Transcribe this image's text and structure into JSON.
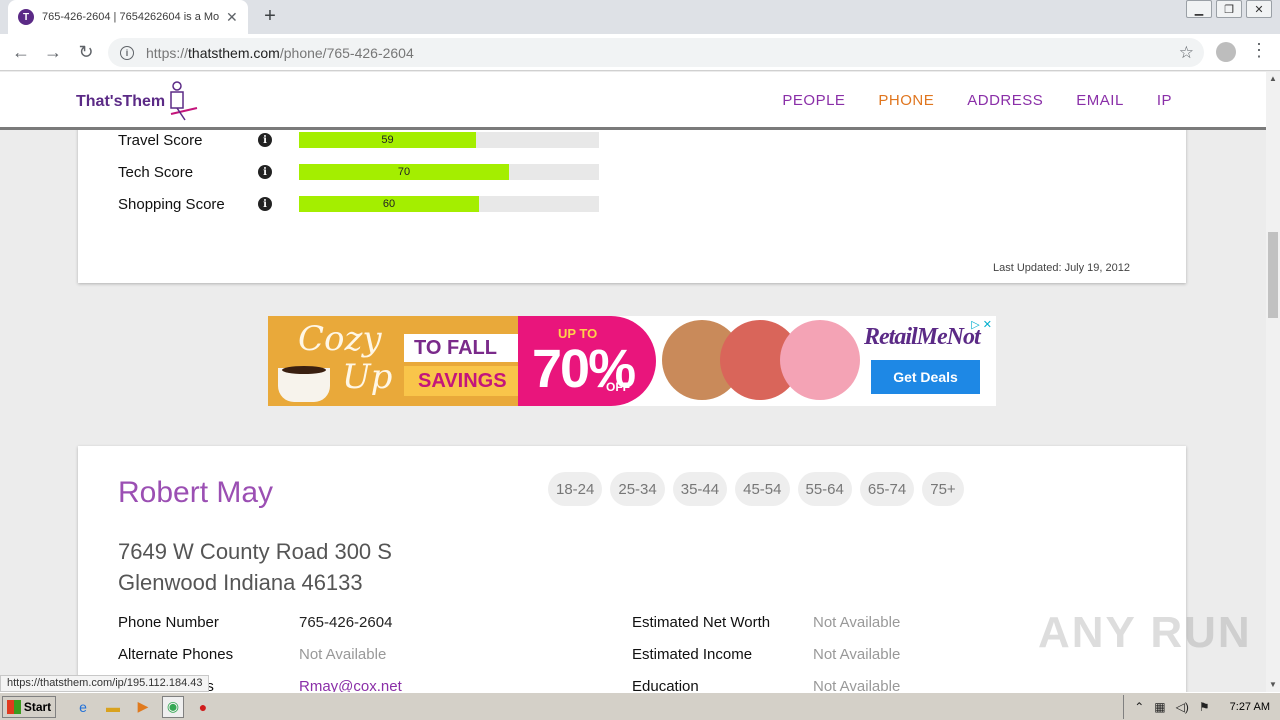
{
  "browser": {
    "tab_title": "765-426-2604 | 7654262604 is a Mo",
    "tab_favicon_letter": "T",
    "url_scheme": "https://",
    "url_host": "thatsthem.com",
    "url_path": "/phone/765-426-2604",
    "status_url": "https://thatsthem.com/ip/195.112.184.43"
  },
  "site": {
    "logo_text": "That'sThem",
    "nav": [
      {
        "label": "PEOPLE",
        "active": false
      },
      {
        "label": "PHONE",
        "active": true
      },
      {
        "label": "ADDRESS",
        "active": false
      },
      {
        "label": "EMAIL",
        "active": false
      },
      {
        "label": "IP",
        "active": false
      }
    ]
  },
  "scores": [
    {
      "label": "Travel Score",
      "value": 59
    },
    {
      "label": "Tech Score",
      "value": 70
    },
    {
      "label": "Shopping Score",
      "value": 60
    }
  ],
  "last_updated": "Last Updated: July 19, 2012",
  "ad": {
    "cozy": "Cozy",
    "up": "Up",
    "to_fall": "TO FALL",
    "savings": "SAVINGS",
    "up_to": "UP TO",
    "percent": "70%",
    "off": "OFF",
    "brand": "RetailMeNot",
    "cta": "Get Deals"
  },
  "person": {
    "name": "Robert May",
    "age_ranges": [
      "18-24",
      "25-34",
      "35-44",
      "45-54",
      "55-64",
      "65-74",
      "75+"
    ],
    "address_line1": "7649 W County Road 300 S",
    "address_line2": "Glenwood Indiana 46133",
    "left_fields": [
      {
        "label": "Phone Number",
        "value": "765-426-2604",
        "kind": "normal"
      },
      {
        "label": "Alternate Phones",
        "value": "Not Available",
        "kind": "na"
      },
      {
        "label": "Email Address",
        "value": "Rmay@cox.net",
        "kind": "link"
      }
    ],
    "right_fields": [
      {
        "label": "Estimated Net Worth",
        "value": "Not Available"
      },
      {
        "label": "Estimated Income",
        "value": "Not Available"
      },
      {
        "label": "Education",
        "value": "Not Available"
      }
    ]
  },
  "watermark": "ANY RUN",
  "taskbar": {
    "start_label": "Start",
    "clock": "7:27 AM"
  },
  "colors": {
    "brand_purple": "#8a2fa8",
    "nav_active": "#e0761f",
    "score_fill": "#a4ee00"
  }
}
